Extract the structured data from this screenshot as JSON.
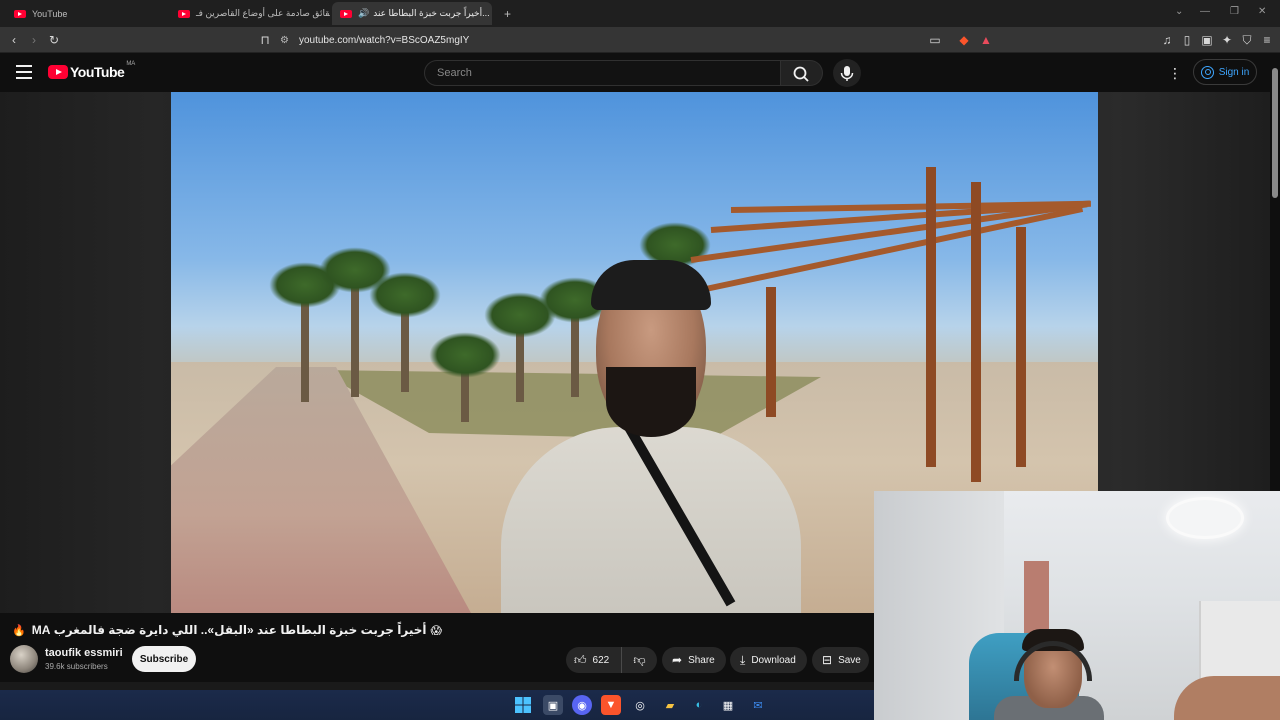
{
  "browser": {
    "tabs": [
      {
        "label": "YouTube"
      },
      {
        "label": "حقائق صادمة على أوضاع القاصرين فـ..."
      },
      {
        "label": "أخيراً جربت خبزة البطاطا عند..."
      }
    ],
    "new_tab": "+",
    "url": "youtube.com/watch?v=BScOAZ5mgIY"
  },
  "youtube": {
    "logo_text": "YouTube",
    "country_code": "MA",
    "search_placeholder": "Search",
    "sign_in": "Sign in"
  },
  "video": {
    "title": "أخيراً جربت خبزة البطاطا عند «البقل».. اللي دايرة ضجة فالمغرب MA",
    "title_emoji_left": "🔥",
    "title_emoji_right": "😱",
    "channel_name": "taoufik essmiri",
    "subscribers": "39.6k subscribers",
    "subscribe_label": "Subscribe",
    "likes": "622",
    "share_label": "Share",
    "download_label": "Download",
    "save_label": "Save"
  },
  "icons": {
    "like": "like-icon",
    "dislike": "dislike-icon",
    "share": "share-icon",
    "download": "download-icon",
    "save": "save-icon"
  },
  "colors": {
    "youtube_red": "#ff0033",
    "link_blue": "#3ea6ff",
    "background": "#0f0f0f"
  }
}
